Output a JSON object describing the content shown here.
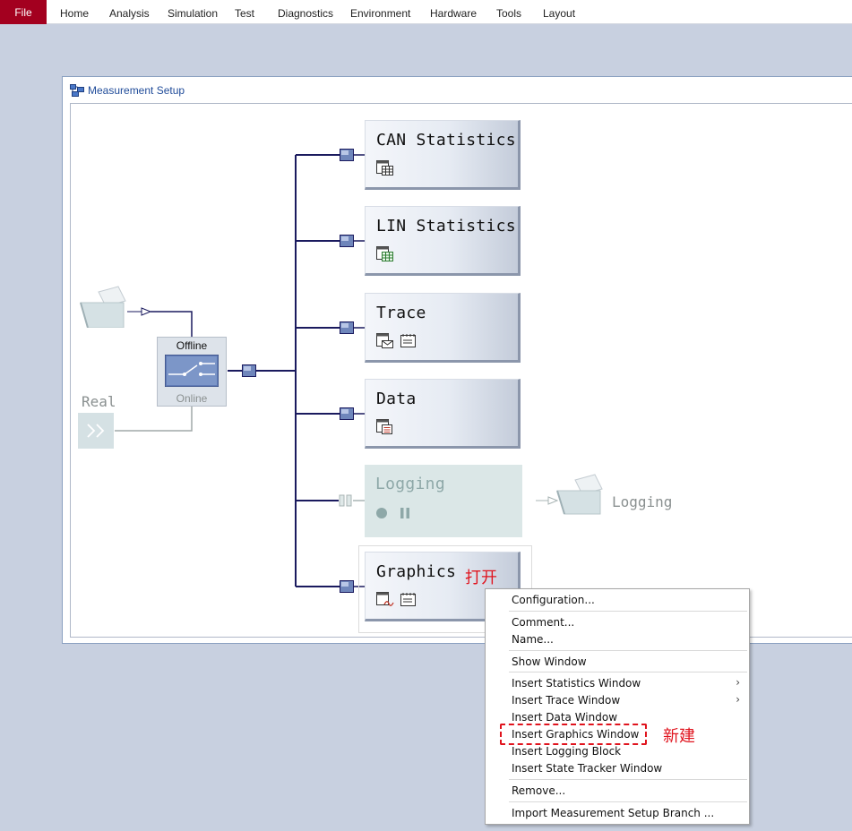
{
  "menubar": {
    "file": "File",
    "items": [
      "Home",
      "Analysis",
      "Simulation",
      "Test",
      "Diagnostics",
      "Environment",
      "Hardware",
      "Tools",
      "Layout"
    ]
  },
  "window": {
    "title": "Measurement Setup"
  },
  "switch": {
    "offline_label": "Offline",
    "online_label": "Online"
  },
  "source": {
    "real_label": "Real"
  },
  "blocks": [
    {
      "name": "CAN Statistics"
    },
    {
      "name": "LIN Statistics"
    },
    {
      "name": "Trace"
    },
    {
      "name": "Data"
    },
    {
      "name": "Logging"
    },
    {
      "name": "Graphics"
    }
  ],
  "logging_target": {
    "label": "Logging"
  },
  "annotations": {
    "open": "打开",
    "new": "新建"
  },
  "context_menu": {
    "items": [
      "Configuration...",
      "Comment...",
      "Name...",
      "Show Window",
      "Insert Statistics Window",
      "Insert Trace Window",
      "Insert Data Window",
      "Insert Graphics Window",
      "Insert Logging Block",
      "Insert State Tracker Window",
      "Remove...",
      "Import Measurement Setup Branch ..."
    ]
  },
  "colors": {
    "accent": "#a3001f",
    "wire": "#1a1a5e",
    "annotation": "#e0141e"
  }
}
